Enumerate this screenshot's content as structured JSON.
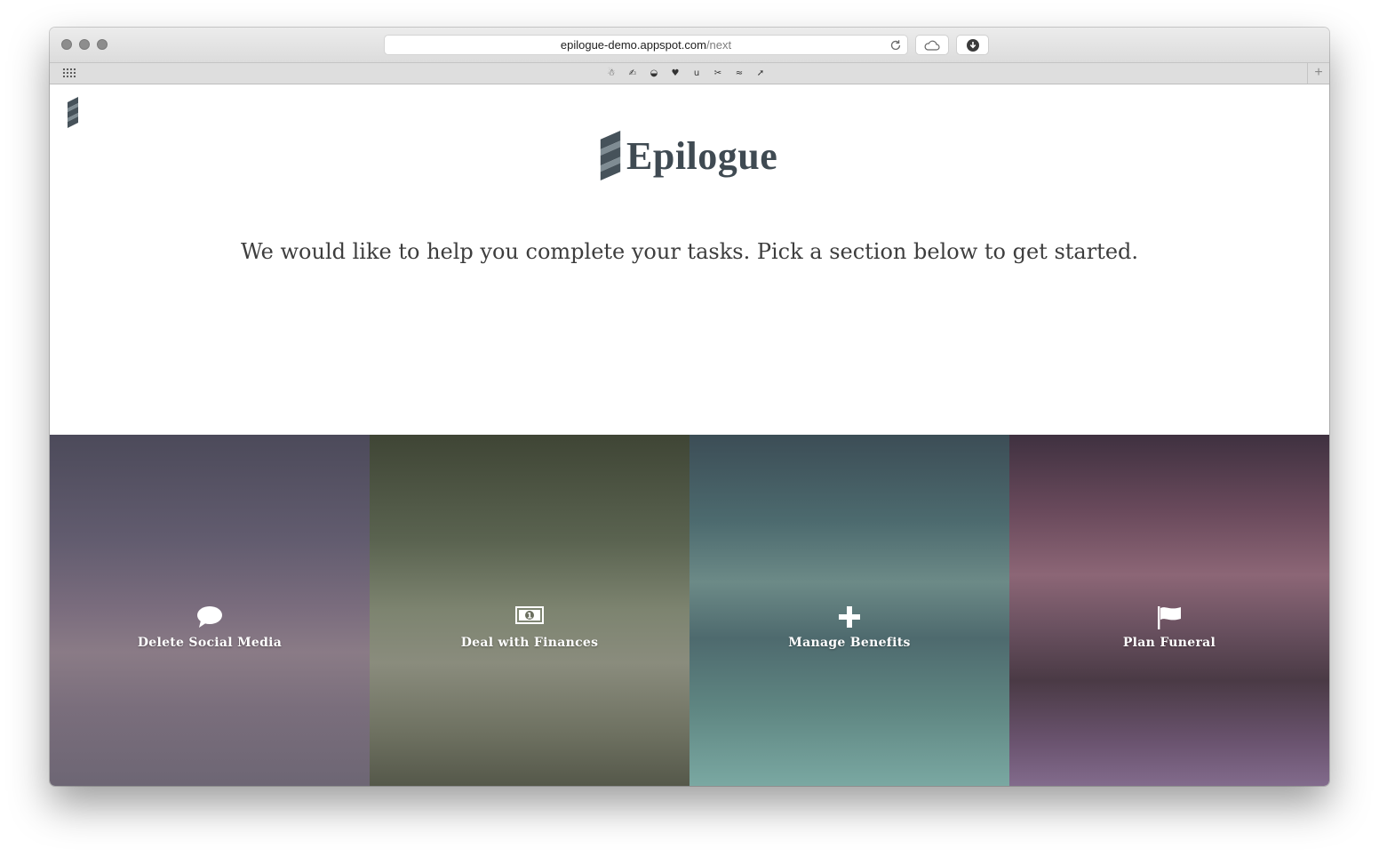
{
  "browser": {
    "url_host": "epilogue-demo.appspot.com",
    "url_path": "/next",
    "reload_icon": "reload-icon",
    "toolbar_icons": [
      "cloud-icon",
      "download-icon"
    ],
    "favorites_glyphs": [
      "☃",
      "✍",
      "◒",
      "♥",
      "u",
      "✂",
      "≈",
      "➚"
    ],
    "new_tab_label": "+"
  },
  "page": {
    "brand_name": "Epilogue",
    "tagline": "We would like to help you complete your tasks. Pick a section below to get started."
  },
  "tiles": [
    {
      "label": "Delete Social Media",
      "icon": "speech-bubble-icon"
    },
    {
      "label": "Deal with Finances",
      "icon": "money-icon"
    },
    {
      "label": "Manage Benefits",
      "icon": "plus-icon"
    },
    {
      "label": "Plan Funeral",
      "icon": "flag-icon"
    }
  ],
  "colors": {
    "brand_text": "#3f4a52",
    "logo_dark": "#46525a",
    "logo_light": "#7f8c93"
  }
}
